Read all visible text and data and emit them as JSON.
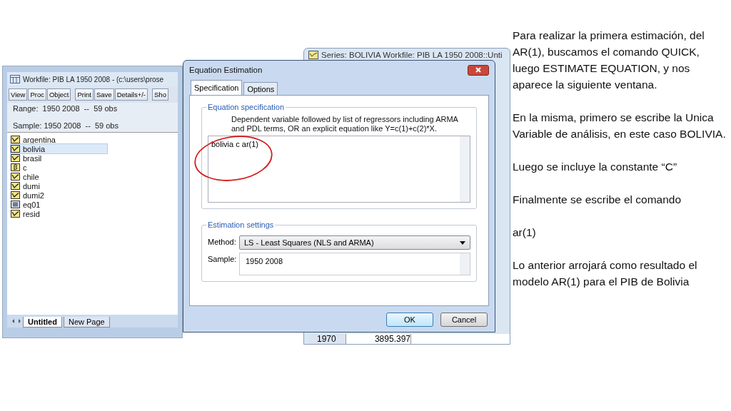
{
  "workfile": {
    "title": "Workfile: PIB LA 1950 2008 - (c:\\users\\prose",
    "toolbar": [
      [
        "View",
        "Proc",
        "Object"
      ],
      [
        "Print",
        "Save",
        "Details+/-"
      ],
      [
        "Sho"
      ]
    ],
    "range": "Range:  1950 2008  --  59 obs",
    "sample": "Sample: 1950 2008  --  59 obs",
    "objects": [
      {
        "name": "argentina",
        "kind": "series",
        "selected": false
      },
      {
        "name": "bolivia",
        "kind": "series",
        "selected": true
      },
      {
        "name": "brasil",
        "kind": "series",
        "selected": false
      },
      {
        "name": "c",
        "kind": "coef",
        "selected": false
      },
      {
        "name": "chile",
        "kind": "series",
        "selected": false
      },
      {
        "name": "dumi",
        "kind": "series",
        "selected": false
      },
      {
        "name": "dumi2",
        "kind": "series",
        "selected": false
      },
      {
        "name": "eq01",
        "kind": "equation",
        "selected": false
      },
      {
        "name": "resid",
        "kind": "series",
        "selected": false
      }
    ],
    "page_tabs": [
      {
        "label": "Untitled",
        "selected": true
      },
      {
        "label": "New Page",
        "selected": false
      }
    ]
  },
  "series_window": {
    "title": "Series: BOLIVIA   Workfile: PIB LA 1950 2008::Unti",
    "rows": [
      {
        "year": "1970",
        "value": "3895.397"
      }
    ]
  },
  "dialog": {
    "title": "Equation Estimation",
    "tabs": [
      {
        "label": "Specification",
        "selected": true
      },
      {
        "label": "Options",
        "selected": false
      }
    ],
    "spec_group": "Equation specification",
    "hint": "Dependent variable followed by list of regressors including ARMA and PDL terms, OR an explicit equation like Y=c(1)+c(2)*X.",
    "equation": "bolivia c ar(1)",
    "settings_group": "Estimation settings",
    "method_label": "Method:",
    "method": "LS  -  Least Squares (NLS and ARMA)",
    "sample_label": "Sample:",
    "sample": "1950 2008",
    "buttons": [
      "OK",
      "Cancel"
    ]
  },
  "notes": [
    "Para realizar la primera estimación, del AR(1), buscamos el comando QUICK, luego ESTIMATE EQUATION, y nos aparece la siguiente ventana.",
    "En la misma, primero se escribe la Unica Variable de análisis, en este caso BOLIVIA.",
    "Luego se incluye la constante “C”",
    "Finalmente se escribe el comando",
    "ar(1)",
    "Lo anterior arrojará como resultado el modelo AR(1) para el PIB de Bolivia"
  ]
}
